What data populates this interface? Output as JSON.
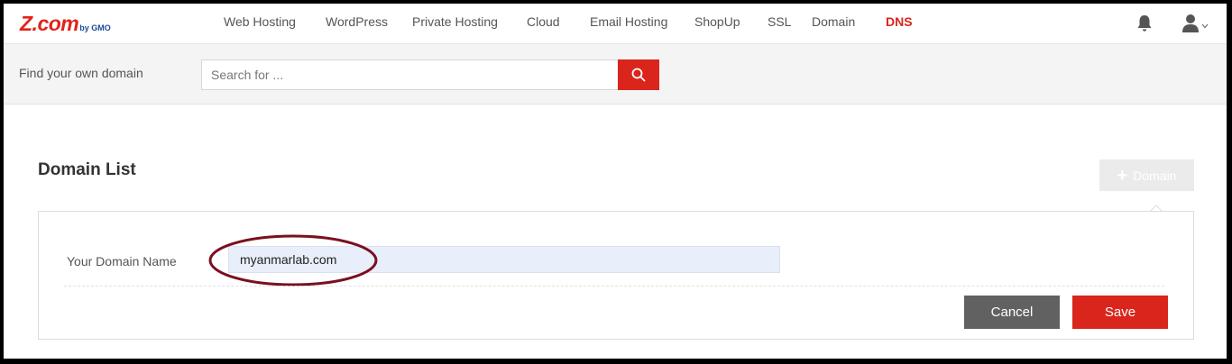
{
  "brand": {
    "logo_main": "Z.com",
    "logo_sub": "by GMO",
    "accent_color": "#d9251c"
  },
  "nav": {
    "items": [
      {
        "label": "Web Hosting"
      },
      {
        "label": "WordPress"
      },
      {
        "label": "Private Hosting"
      },
      {
        "label": "Cloud"
      },
      {
        "label": "Email Hosting"
      },
      {
        "label": "ShopUp"
      },
      {
        "label": "SSL"
      },
      {
        "label": "Domain"
      },
      {
        "label": "DNS",
        "active": true
      }
    ],
    "icons": [
      "bell-icon",
      "user-icon",
      "chevron-down-icon"
    ]
  },
  "search": {
    "label": "Find your own domain",
    "placeholder": "Search for ...",
    "button_icon": "search-icon"
  },
  "main": {
    "title": "Domain List",
    "add_button": {
      "icon": "plus-icon",
      "label": "Domain"
    },
    "form": {
      "field_label": "Your Domain Name",
      "field_value": "myanmarlab.com",
      "cancel_label": "Cancel",
      "save_label": "Save"
    }
  }
}
